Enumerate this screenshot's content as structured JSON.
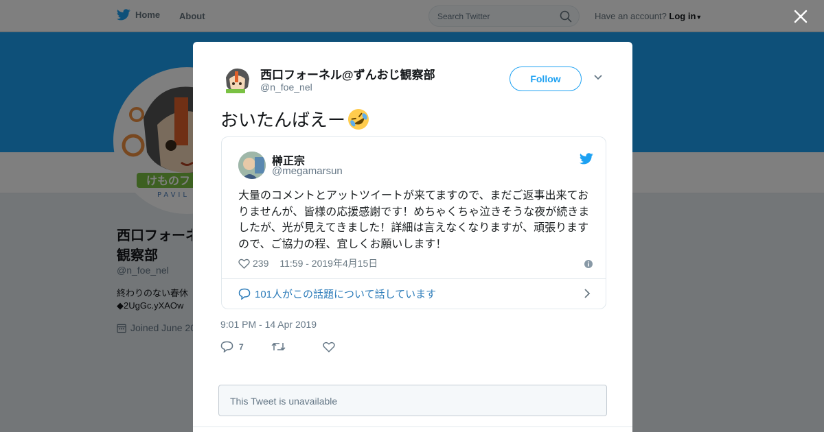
{
  "topnav": {
    "home_label": "Home",
    "about_label": "About",
    "search_placeholder": "Search Twitter",
    "have_account": "Have an account?",
    "login_label": "Log in"
  },
  "background_profile": {
    "name_line1": "西口フォーネル@ずんおじ",
    "name_line2": "観察部",
    "handle": "@n_foe_nel",
    "bio_line1": "終わりのない春休",
    "bio_line2": "◆2UgGc.yXAOw",
    "joined": "Joined June 20"
  },
  "tweet": {
    "author_name": "西口フォーネル@ずんおじ観察部",
    "author_handle": "@n_foe_nel",
    "follow_label": "Follow",
    "text": "おいたんばえー",
    "timestamp": "9:01 PM - 14 Apr 2019",
    "reply_count": "7",
    "retweet_count": "",
    "like_count": ""
  },
  "quoted_tweet": {
    "author_name": "榊正宗",
    "author_handle": "@megamarsun",
    "text": "大量のコメントとアットツイートが来てますので、まだご返事出来ておりませんが、皆様の応援感謝です！めちゃくちゃ泣きそうな夜が続きましたが、光が見えてきました！詳細は言えなくなりますが、頑張りますので、ご協力の程、宜しくお願いします！",
    "likes": "239",
    "time": "11:59 - 2019年4月15日",
    "talking": "101人がこの話題について話しています"
  },
  "unavailable_tweet": {
    "text": "This Tweet is unavailable"
  },
  "colors": {
    "accent": "#1da1f2",
    "link": "#2b7bb9",
    "muted": "#657786"
  }
}
